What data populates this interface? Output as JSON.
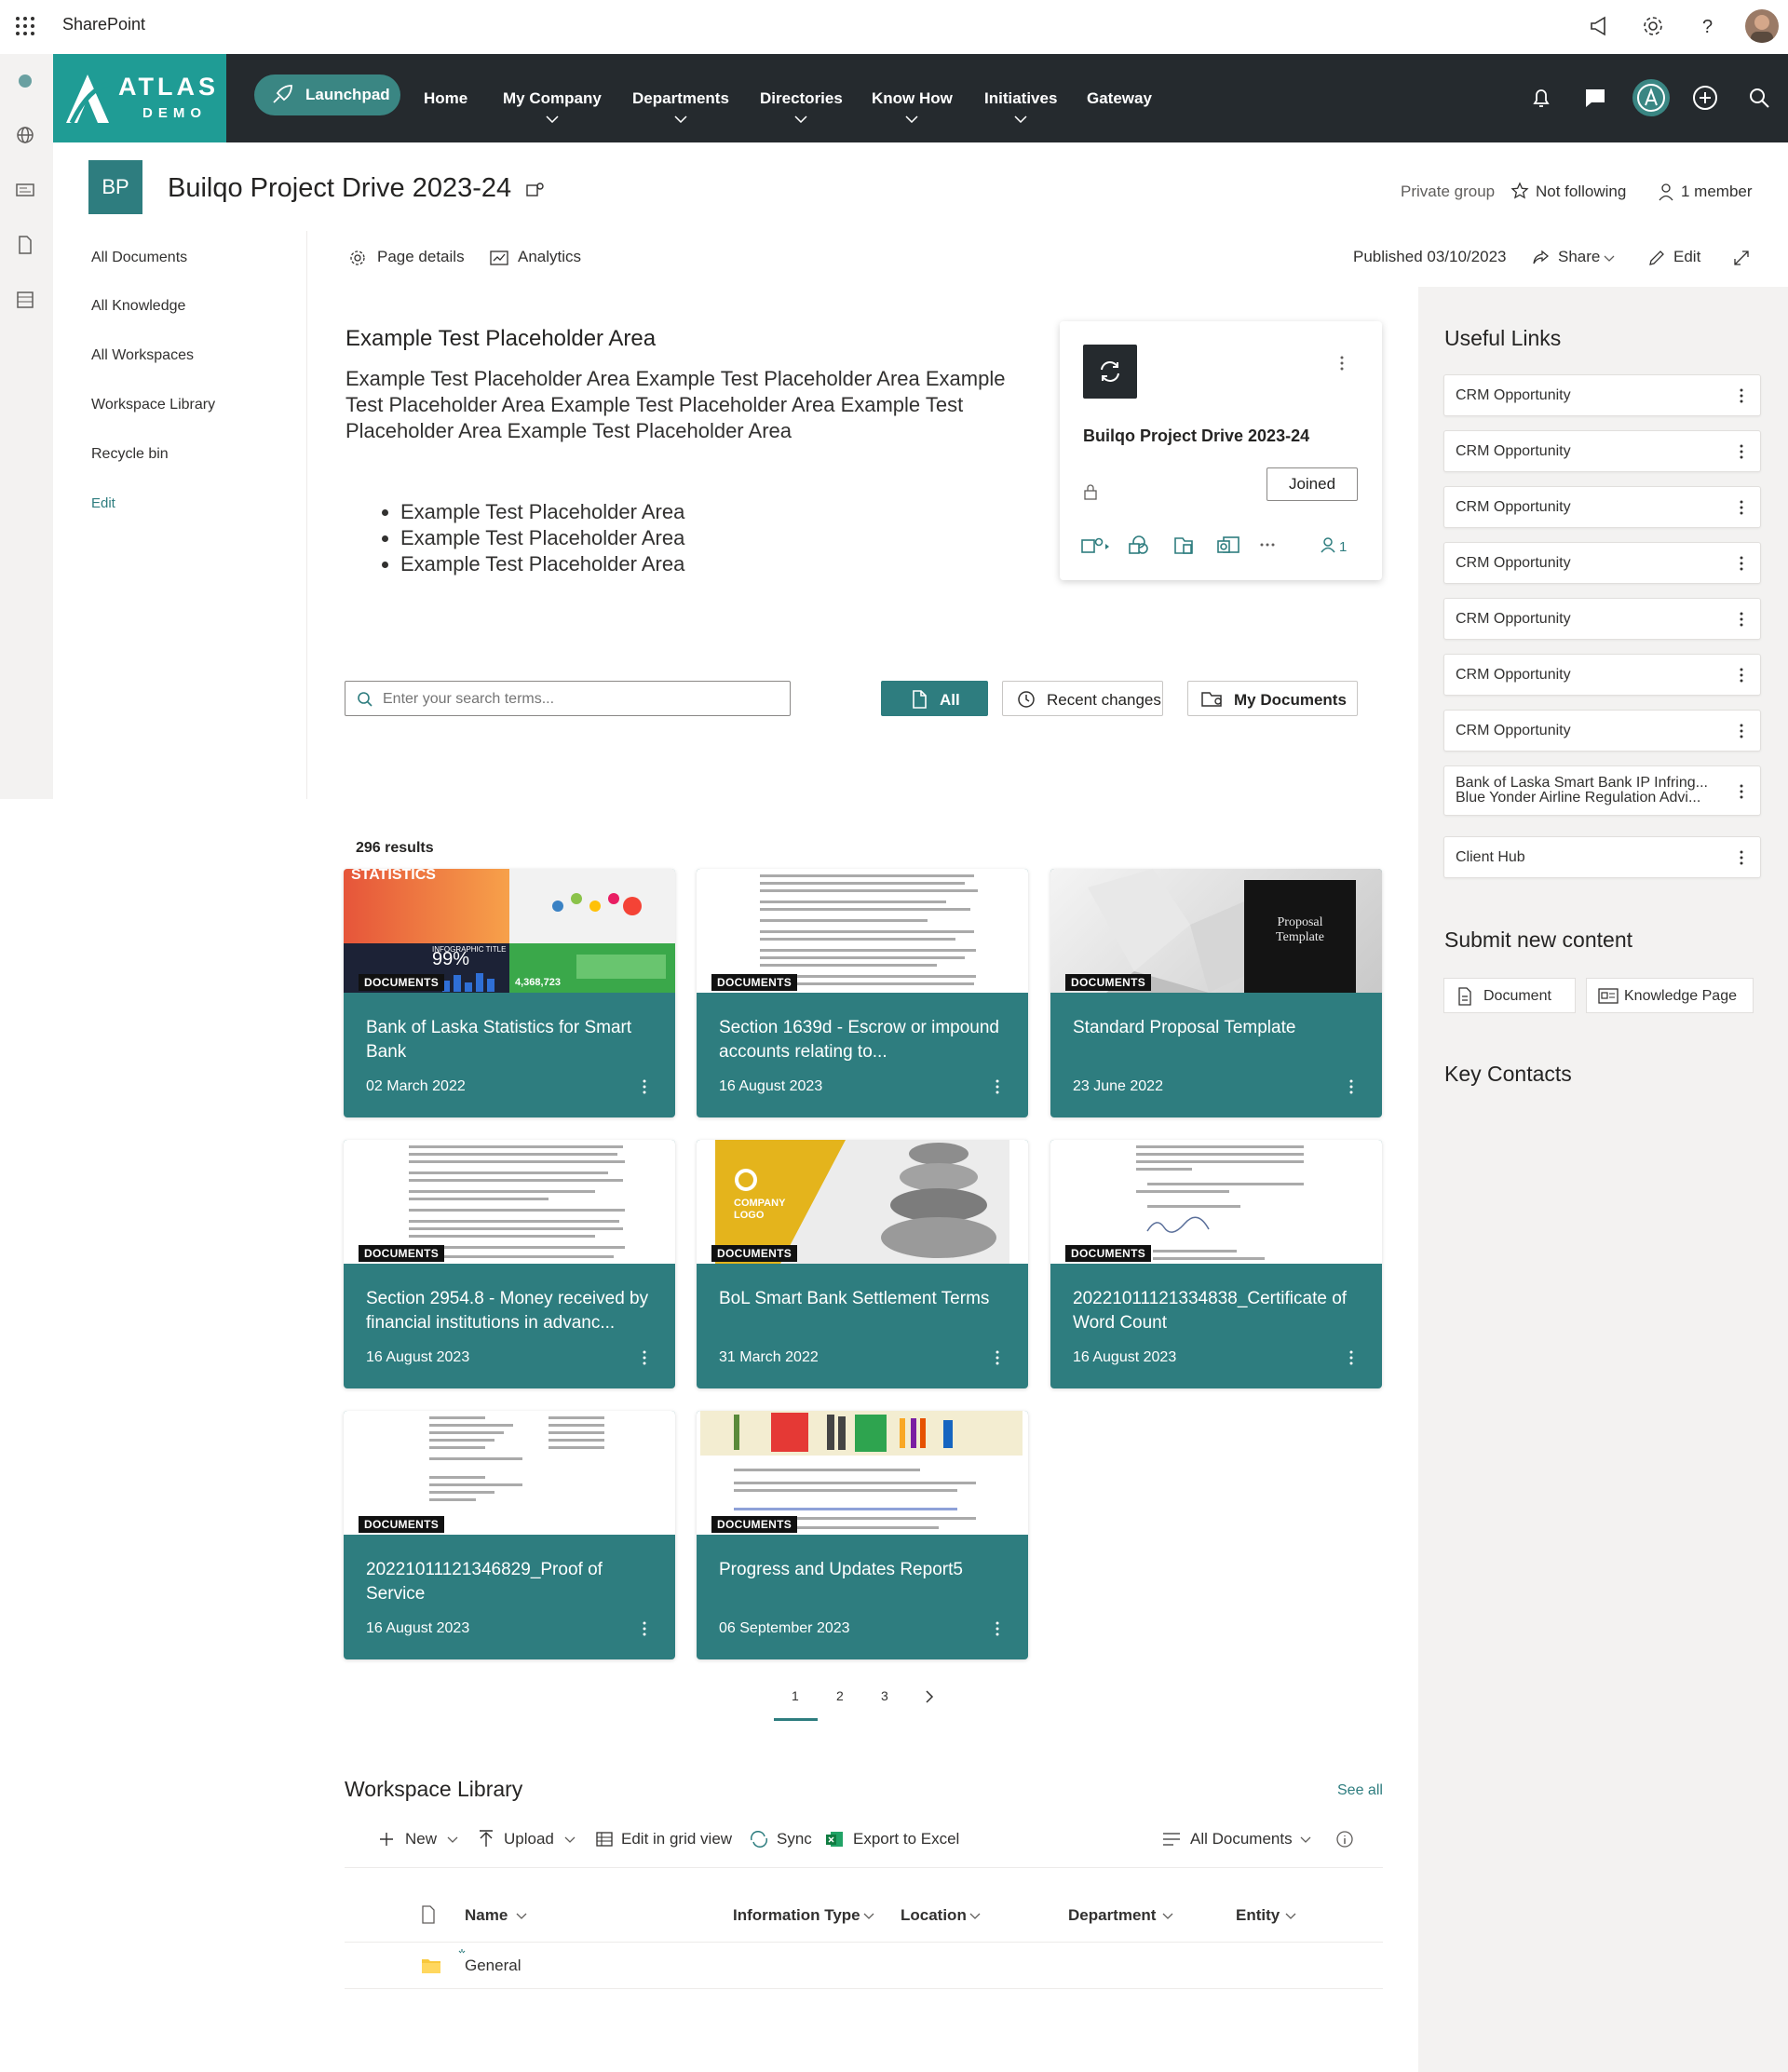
{
  "suite": {
    "app_name": "SharePoint"
  },
  "logo": {
    "line1": "ATLAS",
    "line2": "DEMO"
  },
  "nav": {
    "launchpad": "Launchpad",
    "items": [
      "Home",
      "My Company",
      "Departments",
      "Directories",
      "Know How",
      "Initiatives",
      "Gateway"
    ]
  },
  "site": {
    "initials": "BP",
    "title": "Builqo Project Drive 2023-24",
    "privacy": "Private group",
    "follow": "Not following",
    "members": "1 member"
  },
  "left_nav": [
    "All Documents",
    "All Knowledge",
    "All Workspaces",
    "Workspace Library",
    "Recycle bin",
    "Edit"
  ],
  "command_bar": {
    "page_details": "Page details",
    "analytics": "Analytics",
    "published": "Published 03/10/2023",
    "share": "Share",
    "edit": "Edit"
  },
  "placeholder": {
    "title": "Example Test Placeholder Area",
    "body": "Example Test Placeholder Area Example Test Placeholder Area Example Test Placeholder Area Example Test Placeholder Area Example Test Placeholder Area Example Test Placeholder Area",
    "bullets": [
      "Example Test Placeholder Area",
      "Example Test Placeholder Area",
      "Example Test Placeholder Area"
    ]
  },
  "group_card": {
    "name": "Builqo Project Drive 2023-24",
    "joined": "Joined",
    "member_count": "1"
  },
  "search": {
    "placeholder": "Enter your search terms...",
    "filters": [
      "All",
      "Recent changes",
      "My Documents"
    ],
    "results": "296 results"
  },
  "documents": [
    {
      "title": "Bank of Laska Statistics for Smart Bank",
      "date": "02 March 2022",
      "badge": "DOCUMENTS",
      "thumb": "stats"
    },
    {
      "title": "Section 1639d - Escrow or impound accounts relating to...",
      "date": "16 August 2023",
      "badge": "DOCUMENTS",
      "thumb": "doc"
    },
    {
      "title": "Standard Proposal Template",
      "date": "23 June 2022",
      "badge": "DOCUMENTS",
      "thumb": "proposal"
    },
    {
      "title": "Section 2954.8 - Money received by financial institutions in advanc...",
      "date": "16 August 2023",
      "badge": "DOCUMENTS",
      "thumb": "doc"
    },
    {
      "title": "BoL Smart Bank Settlement Terms",
      "date": "31 March 2022",
      "badge": "DOCUMENTS",
      "thumb": "stones"
    },
    {
      "title": "20221011121334838_Certificate of Word Count",
      "date": "16 August 2023",
      "badge": "DOCUMENTS",
      "thumb": "doc"
    },
    {
      "title": "20221011121346829_Proof of Service",
      "date": "16 August 2023",
      "badge": "DOCUMENTS",
      "thumb": "doc"
    },
    {
      "title": "Progress and Updates Report5",
      "date": "06 September 2023",
      "badge": "DOCUMENTS",
      "thumb": "bars"
    }
  ],
  "thumb_text": {
    "statistics": "STATISTICS",
    "infographic": "INFOGRAPHIC TITLE",
    "percent": "99%",
    "count": "4,368,723",
    "proposal": "Proposal Template",
    "company_logo": "COMPANY LOGO"
  },
  "pager": {
    "pages": [
      "1",
      "2",
      "3"
    ],
    "current": "1"
  },
  "useful_links": {
    "title": "Useful Links",
    "items": [
      {
        "label": "CRM Opportunity"
      },
      {
        "label": "CRM Opportunity"
      },
      {
        "label": "CRM Opportunity"
      },
      {
        "label": "CRM Opportunity"
      },
      {
        "label": "CRM Opportunity"
      },
      {
        "label": "CRM Opportunity"
      },
      {
        "label": "CRM Opportunity"
      },
      {
        "label": "Bank of Laska Smart Bank IP Infring...",
        "label2": "Blue Yonder Airline Regulation Advi..."
      },
      {
        "label": "Client Hub"
      }
    ]
  },
  "submit": {
    "title": "Submit new content",
    "document": "Document",
    "knowledge": "Knowledge Page"
  },
  "key_contacts": {
    "title": "Key Contacts"
  },
  "workspace_library": {
    "title": "Workspace Library",
    "see_all": "See all",
    "commands": [
      "New",
      "Upload",
      "Edit in grid view",
      "Sync",
      "Export to Excel"
    ],
    "view": "All Documents",
    "columns": [
      "Name",
      "Information Type",
      "Location",
      "Department",
      "Entity"
    ],
    "rows": [
      {
        "name": "General"
      }
    ]
  },
  "colors": {
    "accent": "#2e7d7f",
    "nav_bg": "#252a2e",
    "logo_bg": "#1f9c95",
    "rail_bg": "#f3f2f1"
  }
}
